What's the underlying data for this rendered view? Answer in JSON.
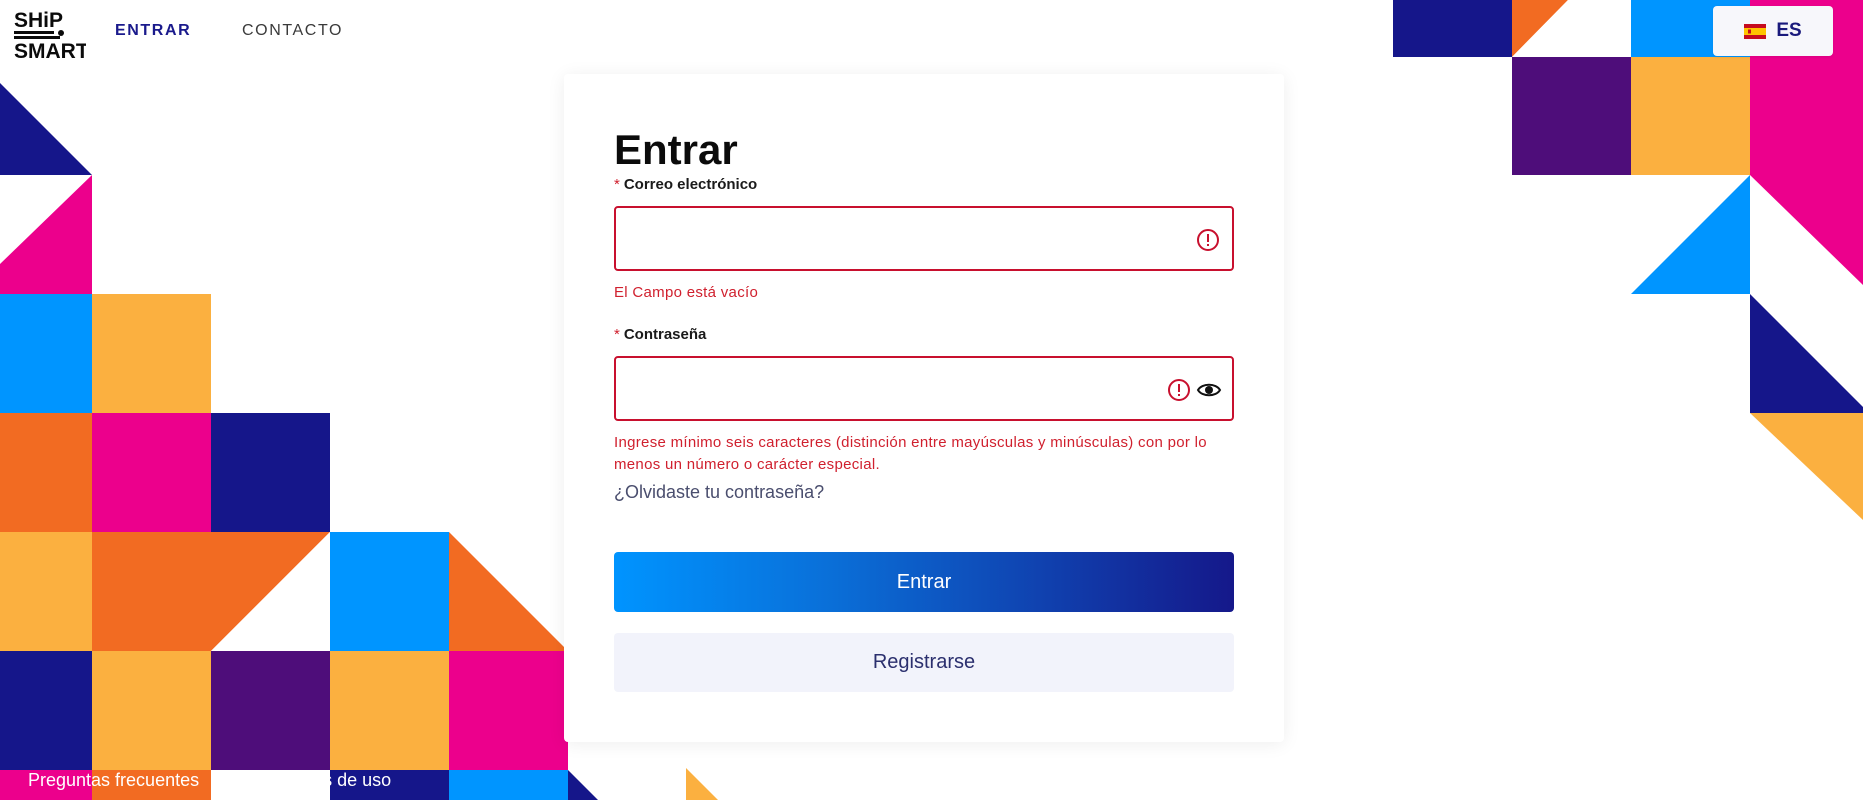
{
  "brand": {
    "logo_line1": "SHiP",
    "logo_line2": "SMART"
  },
  "nav": {
    "entrar": "ENTRAR",
    "contacto": "CONTACTO"
  },
  "language": {
    "label": "ES",
    "flag": "spain-flag-icon"
  },
  "login": {
    "title": "Entrar",
    "email": {
      "required_mark": "*",
      "label": "Correo electrónico",
      "value": "",
      "placeholder": "",
      "error": "El Campo está vacío"
    },
    "password": {
      "required_mark": "*",
      "label": "Contraseña",
      "value": "",
      "placeholder": "",
      "error": "Ingrese mínimo seis caracteres (distinción entre mayúsculas y minúsculas) con por lo menos un número o carácter especial."
    },
    "forgot": "¿Olvidaste tu contraseña?",
    "submit": "Entrar",
    "register": "Registrarse"
  },
  "footer": {
    "faq": "Preguntas frecuentes",
    "terms": "Términos de uso"
  },
  "colors": {
    "navy": "#15168a",
    "orange": "#f26b22",
    "magenta": "#ec008c",
    "blue": "#0095ff",
    "amber": "#fbb040",
    "purple": "#4e0d7a",
    "error": "#c8102e",
    "button_gradient_start": "#0094ff",
    "button_gradient_end": "#15188a"
  }
}
